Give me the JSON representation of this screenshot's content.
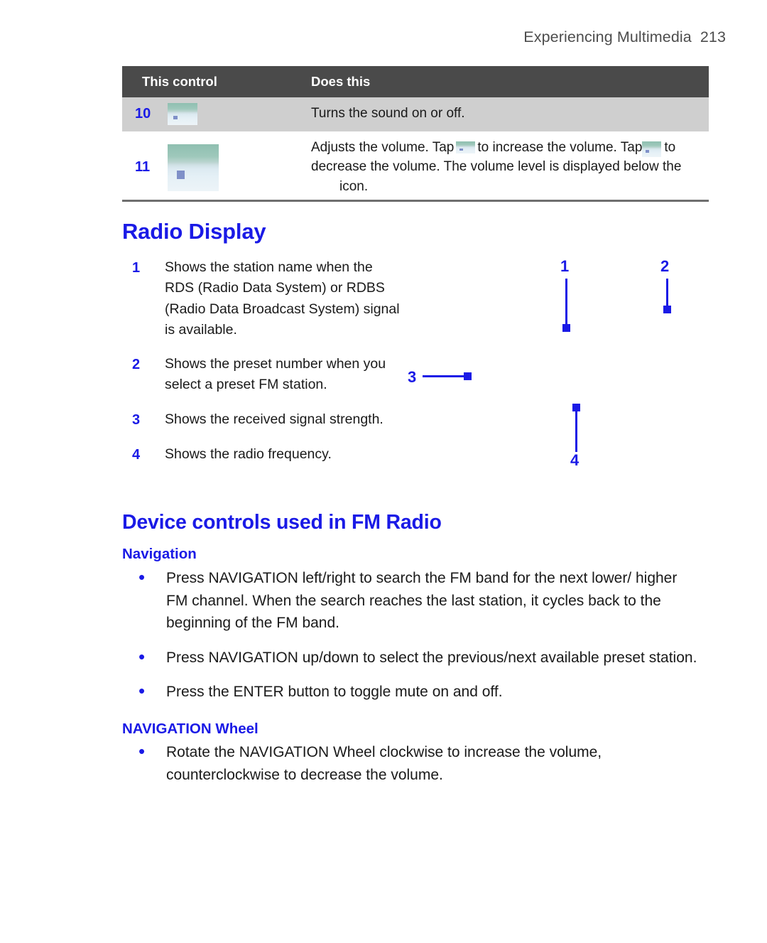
{
  "header": {
    "title": "Experiencing Multimedia",
    "page_number": "213"
  },
  "control_table": {
    "columns": [
      "This control",
      "Does this"
    ],
    "rows": [
      {
        "number": "10",
        "icon": "sound-toggle-thumbnail",
        "description": "Turns the sound on or off."
      },
      {
        "number": "11",
        "icon": "volume-slider-thumbnail",
        "text_part_1": "Adjusts the volume. Tap",
        "inline_icon_1": "volume-up-thumbnail",
        "text_part_2": "to increase the volume. Tap",
        "inline_icon_2": "volume-down-thumbnail",
        "text_part_3": "to decrease the volume. The volume level is displayed below the",
        "inline_icon_3": "speaker-thumbnail",
        "text_part_4": "icon."
      }
    ]
  },
  "radio_display": {
    "heading": "Radio Display",
    "items": [
      {
        "number": "1",
        "text": "Shows the station name when the RDS (Radio Data System) or RDBS (Radio Data Broadcast System) signal is available."
      },
      {
        "number": "2",
        "text": "Shows the preset number when you select a preset FM station."
      },
      {
        "number": "3",
        "text": "Shows the received signal strength."
      },
      {
        "number": "4",
        "text": "Shows the radio frequency."
      }
    ],
    "callouts": [
      {
        "label": "1"
      },
      {
        "label": "2"
      },
      {
        "label": "3"
      },
      {
        "label": "4"
      }
    ]
  },
  "device_controls": {
    "heading": "Device controls used in FM Radio",
    "sections": [
      {
        "subheading": "Navigation",
        "bullets": [
          "Press NAVIGATION left/right to search the FM band for the next lower/ higher FM channel. When the search reaches the last station, it cycles back to the beginning of the FM band.",
          "Press NAVIGATION up/down to select the previous/next available preset station.",
          "Press the ENTER button to toggle mute on and off."
        ]
      },
      {
        "subheading": "NAVIGATION Wheel",
        "bullets": [
          "Rotate the NAVIGATION Wheel clockwise to increase the volume, counterclockwise to decrease the volume."
        ]
      }
    ]
  },
  "colors": {
    "accent_blue": "#1a1ae6",
    "table_header_bg": "#4a4a4a",
    "table_row_shaded_bg": "#cfcfcf",
    "rule": "#6e6e6e",
    "header_text": "#4d4d4d"
  },
  "bullet_glyph": "•"
}
